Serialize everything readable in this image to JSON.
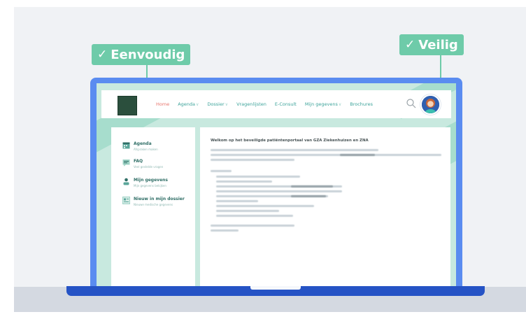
{
  "annotations": {
    "left": {
      "check": "✓",
      "label": "Eenvoudig"
    },
    "right": {
      "check": "✓",
      "label": "Veilig"
    }
  },
  "nav": {
    "items": [
      {
        "label": "Home",
        "active": true,
        "dropdown": false
      },
      {
        "label": "Agenda",
        "active": false,
        "dropdown": true
      },
      {
        "label": "Dossier",
        "active": false,
        "dropdown": true
      },
      {
        "label": "Vragenlijsten",
        "active": false,
        "dropdown": false
      },
      {
        "label": "E-Consult",
        "active": false,
        "dropdown": false
      },
      {
        "label": "Mijn gegevens",
        "active": false,
        "dropdown": true
      },
      {
        "label": "Brochures",
        "active": false,
        "dropdown": false
      }
    ],
    "search_icon": "search-icon",
    "avatar_icon": "user-avatar"
  },
  "sidebar": {
    "items": [
      {
        "title": "Agenda",
        "subtitle": "Afspraken maken",
        "icon": "calendar-icon"
      },
      {
        "title": "FAQ",
        "subtitle": "Veel gestelde vragen",
        "icon": "chat-icon"
      },
      {
        "title": "Mijn gegevens",
        "subtitle": "Mijn gegevens bekijken",
        "icon": "person-icon"
      },
      {
        "title": "Nieuw in mijn dossier",
        "subtitle": "Nieuwe medische gegevens",
        "icon": "document-icon"
      }
    ]
  },
  "content": {
    "title": "Welkom op het beveiligde patiëntenportaal van GZA Ziekenhuizen en ZNA"
  },
  "colors": {
    "accent_green": "#6ecba9",
    "laptop_blue": "#5a8cf0",
    "base_blue": "#2553c5",
    "nav_teal": "#3ca39a",
    "nav_active": "#e8766e"
  }
}
